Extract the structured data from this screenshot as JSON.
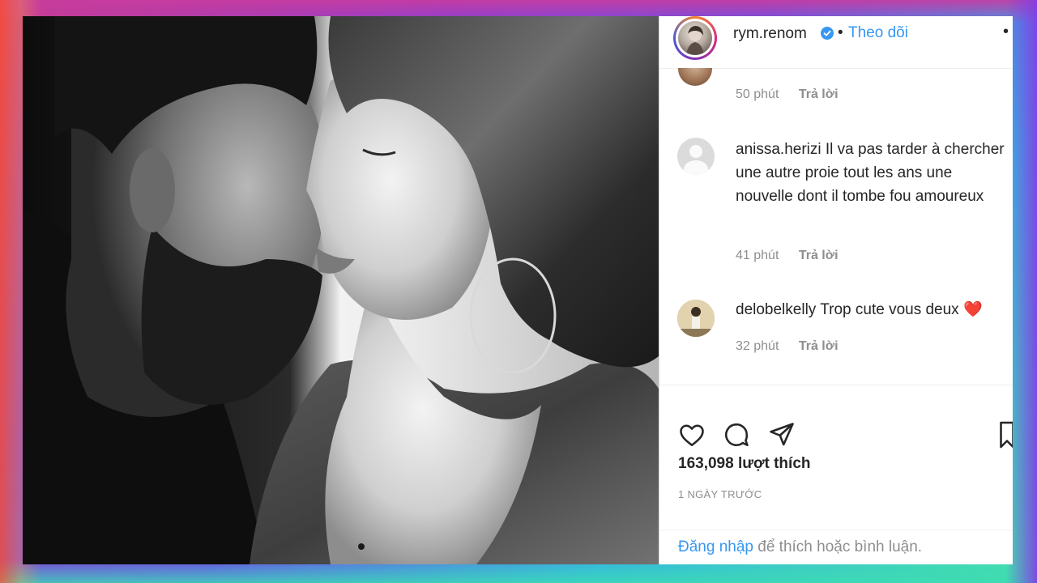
{
  "post": {
    "username": "rym.renom",
    "separator": "•",
    "follow_label": "Theo dõi",
    "more_label": "•"
  },
  "comments": [
    {
      "time": "50 phút",
      "reply_label": "Trả lời"
    },
    {
      "username": "anissa.herizi",
      "text": "Il va pas tarder à chercher une autre proie tout les ans une nouvelle dont il tombe fou amoureux",
      "time": "41 phút",
      "reply_label": "Trả lời"
    },
    {
      "username": "delobelkelly",
      "text": "Trop cute vous deux",
      "emoji": "❤️",
      "time": "32 phút",
      "reply_label": "Trả lời"
    }
  ],
  "actions": {
    "like_icon": "heart-outline-icon",
    "comment_icon": "comment-bubble-icon",
    "share_icon": "paper-plane-icon",
    "save_icon": "bookmark-icon",
    "likes_count": "163,098 lượt thích",
    "date": "1 NGÀY TRƯỚC"
  },
  "login": {
    "link_label": "Đăng nhập",
    "rest_text": " để thích hoặc bình luận."
  },
  "colors": {
    "link_blue": "#3797f0",
    "verified_blue": "#3897f0",
    "text_dark": "#262626",
    "text_muted": "#8e8e8e"
  }
}
